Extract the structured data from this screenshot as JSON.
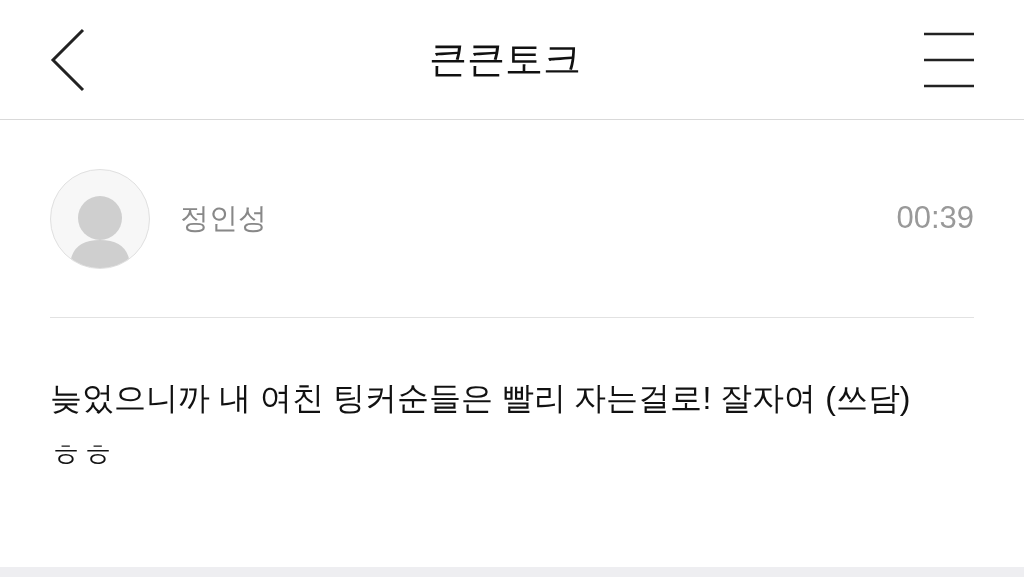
{
  "header": {
    "title": "큰큰토크"
  },
  "post": {
    "author": "정인성",
    "time": "00:39",
    "message": "늦었으니까 내 여친 팅커순들은 빨리 자는걸로! 잘자여 (쓰담) ㅎㅎ"
  }
}
